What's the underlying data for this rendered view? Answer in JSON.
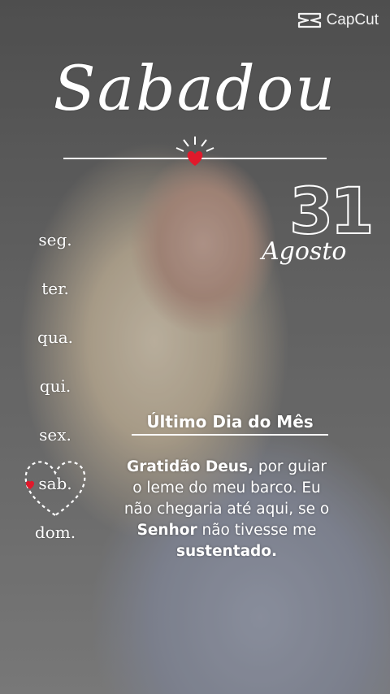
{
  "brand": {
    "name": "CapCut",
    "icon": "capcut-logo-icon"
  },
  "title": "Sabadou",
  "date": {
    "day": "31",
    "month": "Agosto"
  },
  "weekdays": [
    {
      "label": "seg."
    },
    {
      "label": "ter."
    },
    {
      "label": "qua."
    },
    {
      "label": "qui."
    },
    {
      "label": "sex."
    },
    {
      "label": "sab.",
      "highlighted": true
    },
    {
      "label": "dom."
    }
  ],
  "headline": "Último Dia do Mês",
  "message": {
    "part1_bold": "Gratidão Deus,",
    "part2": " por guiar o leme do meu barco. Eu não chegaria até aqui, se o ",
    "part3_bold": "Senhor",
    "part4": " não tivesse me ",
    "part5_bold": "sustentado."
  },
  "colors": {
    "accent_heart": "#e0192b",
    "text": "#ffffff"
  }
}
